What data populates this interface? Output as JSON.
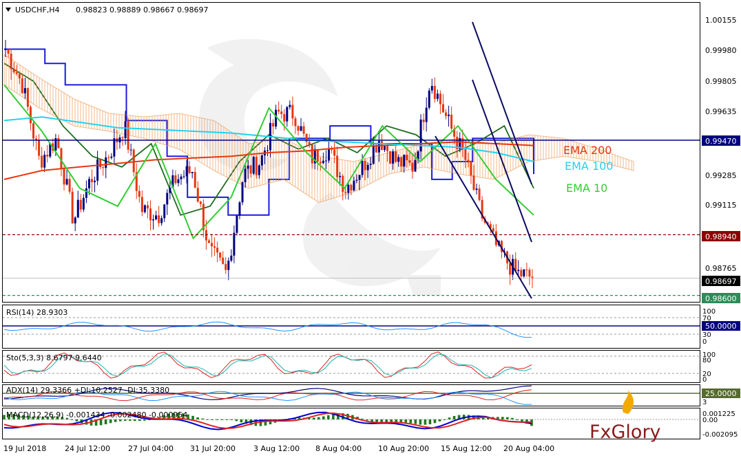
{
  "header": {
    "symbol": "USDCHF,H4",
    "ohlc": "0.98823 0.98889 0.98667 0.98697"
  },
  "price_axis": {
    "ticks": [
      "1.00155",
      "0.99980",
      "0.99805",
      "0.99635",
      "0.99470",
      "0.99285",
      "0.99115",
      "0.98940",
      "0.98765",
      "0.98697",
      "0.98600"
    ],
    "levels": {
      "resistance": {
        "value": 0.9947,
        "label": "0.99470",
        "color": "#000080"
      },
      "support1": {
        "value": 0.9894,
        "label": "0.98940",
        "color": "#8b0000"
      },
      "current": {
        "value": 0.98697,
        "label": "0.98697",
        "color": "#000000"
      },
      "support2": {
        "value": 0.986,
        "label": "0.98600",
        "color": "#2e8b57"
      }
    }
  },
  "legend": {
    "ema200": {
      "label": "EMA 200",
      "color": "#e8360e"
    },
    "ema100": {
      "label": "EMA 100",
      "color": "#22d3ee"
    },
    "ema10": {
      "label": "EMA 10",
      "color": "#32cd32"
    }
  },
  "x_axis": {
    "labels": [
      "19 Jul 2018",
      "24 Jul 12:00",
      "27 Jul 04:00",
      "31 Jul 20:00",
      "3 Aug 12:00",
      "8 Aug 04:00",
      "10 Aug 20:00",
      "15 Aug 12:00",
      "20 Aug 04:00"
    ]
  },
  "indicators": {
    "rsi": {
      "label": "RSI(14) 28.9303",
      "ticks": [
        "100",
        "70",
        "50.0000",
        "30",
        "0"
      ],
      "highlight": "50.0000",
      "color": "#1e90ff"
    },
    "stoch": {
      "label": "Sto(5,3,3) 8.6797 9.6440",
      "ticks": [
        "100",
        "80",
        "20",
        "0"
      ]
    },
    "adx": {
      "label": "ADX(14) 29.3366 +DI:10.2527 -DI:35.3380",
      "highlight": "25.0000",
      "ticks": [
        "3"
      ]
    },
    "macd": {
      "label": "MACD(12,26,9) -0.001434 -0.002480 -0.000954",
      "ticks": [
        "0.001225",
        "0.00",
        "-0.002095"
      ]
    }
  },
  "brand": {
    "name": "FxGlory"
  },
  "chart_data": {
    "type": "candlestick",
    "symbol": "USDCHF",
    "timeframe": "H4",
    "ylim": [
      0.9856,
      1.0024
    ],
    "x": [
      "19 Jul 2018",
      "24 Jul 12:00",
      "27 Jul 04:00",
      "31 Jul 20:00",
      "3 Aug 12:00",
      "8 Aug 04:00",
      "10 Aug 20:00",
      "15 Aug 12:00",
      "20 Aug 04:00"
    ],
    "close_path": [
      0.9998,
      0.9978,
      0.9935,
      0.9948,
      0.9902,
      0.9925,
      0.9938,
      0.9955,
      0.9908,
      0.9905,
      0.9925,
      0.993,
      0.9885,
      0.9872,
      0.9928,
      0.9935,
      0.9962,
      0.9962,
      0.9937,
      0.9942,
      0.992,
      0.9932,
      0.9948,
      0.9935,
      0.9932,
      0.9982,
      0.9958,
      0.9938,
      0.9905,
      0.9885,
      0.9873,
      0.987
    ],
    "current_price": 0.98697,
    "levels": [
      0.9947,
      0.9894,
      0.986
    ],
    "series": [
      {
        "name": "EMA 200",
        "values": [
          0.9925,
          0.993,
          0.9932,
          0.9934,
          0.9936,
          0.9937,
          0.9938,
          0.994,
          0.9941,
          0.9943,
          0.9944,
          0.9945,
          0.9946,
          0.9945,
          0.9944
        ]
      },
      {
        "name": "EMA 100",
        "values": [
          0.9958,
          0.996,
          0.9957,
          0.9954,
          0.9953,
          0.9952,
          0.9951,
          0.9949,
          0.9947,
          0.9946,
          0.9945,
          0.9944,
          0.9943,
          0.994,
          0.9935
        ]
      },
      {
        "name": "EMA 10",
        "values": [
          0.9978,
          0.9952,
          0.992,
          0.991,
          0.9945,
          0.9892,
          0.9915,
          0.9965,
          0.994,
          0.992,
          0.9955,
          0.9935,
          0.9955,
          0.9925,
          0.9905
        ]
      }
    ]
  }
}
